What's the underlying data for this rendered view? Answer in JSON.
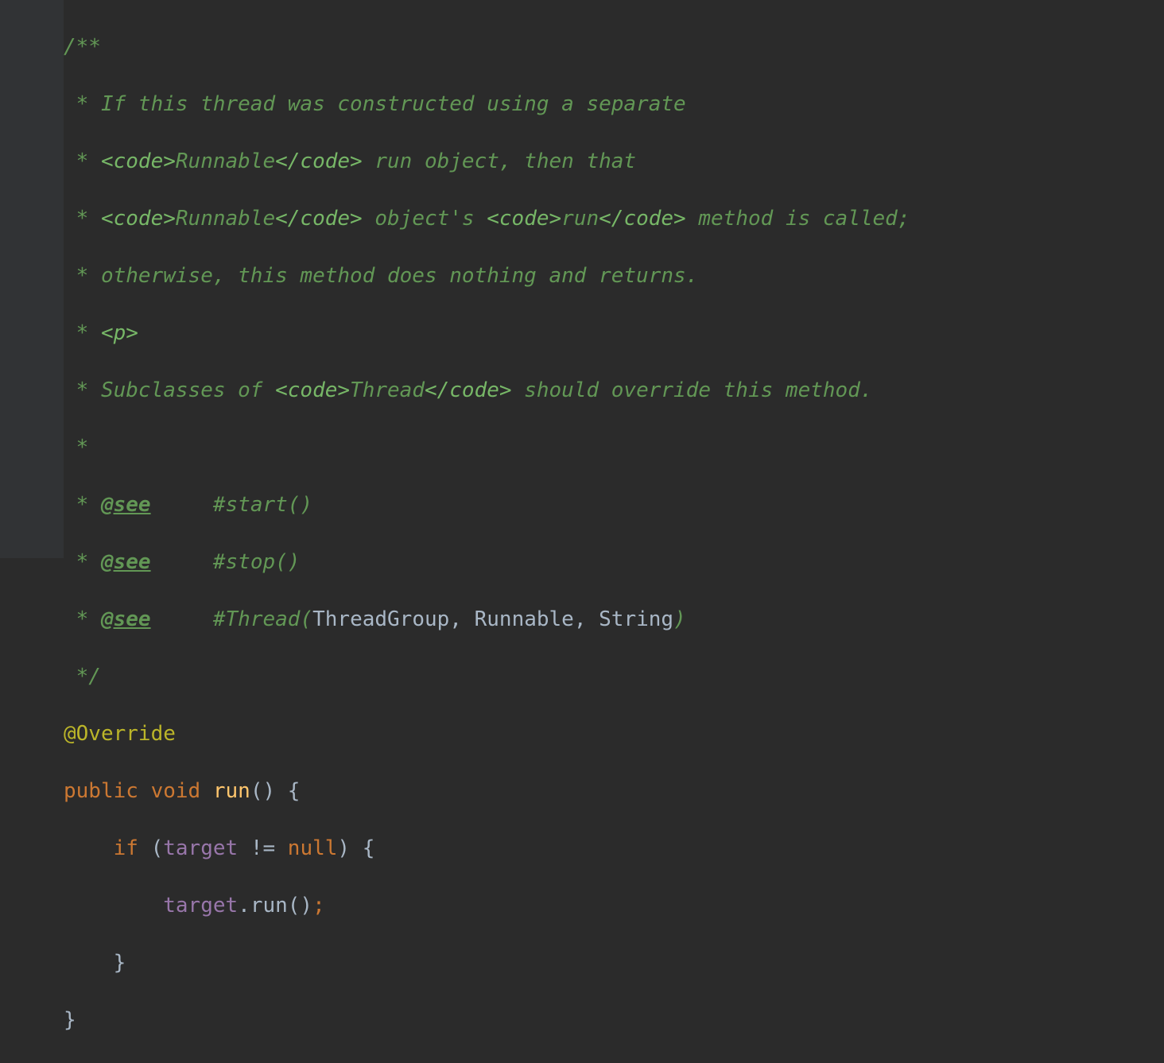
{
  "code": {
    "l1": {
      "t1": "/**"
    },
    "l2": {
      "t1": " * ",
      "t2": "If this thread was constructed using a separate"
    },
    "l3": {
      "t1": " * ",
      "t2": "<code>",
      "t3": "Runnable",
      "t4": "</code> ",
      "t5": "run object, then that"
    },
    "l4": {
      "t1": " * ",
      "t2": "<code>",
      "t3": "Runnable",
      "t4": "</code> ",
      "t5": "object's ",
      "t6": "<code>",
      "t7": "run",
      "t8": "</code> ",
      "t9": "method is called;"
    },
    "l5": {
      "t1": " * ",
      "t2": "otherwise, this method does nothing and returns."
    },
    "l6": {
      "t1": " * ",
      "t2": "<p>"
    },
    "l7": {
      "t1": " * ",
      "t2": "Subclasses of ",
      "t3": "<code>",
      "t4": "Thread",
      "t5": "</code> ",
      "t6": "should override this method."
    },
    "l8": {
      "t1": " *"
    },
    "l9": {
      "t1": " * ",
      "t2": "@see",
      "t3": "     ",
      "t4": "#start()"
    },
    "l10": {
      "t1": " * ",
      "t2": "@see",
      "t3": "     ",
      "t4": "#stop()"
    },
    "l11": {
      "t1": " * ",
      "t2": "@see",
      "t3": "     ",
      "t4": "#Thread(",
      "t5": "ThreadGroup, Runnable, String",
      "t6": ")"
    },
    "l12": {
      "t1": " */"
    },
    "l13": {
      "t1": "@Override"
    },
    "l14": {
      "t1": "public",
      "t2": " ",
      "t3": "void",
      "t4": " ",
      "t5": "run",
      "t6": "() {"
    },
    "l15": {
      "t1": "    ",
      "t2": "if",
      "t3": " (",
      "t4": "target",
      "t5": " != ",
      "t6": "null",
      "t7": ") {"
    },
    "l16": {
      "t1": "        ",
      "t2": "target",
      "t3": ".",
      "t4": "run",
      "t5": "()",
      "t6": ";"
    },
    "l17": {
      "t1": "    }"
    },
    "l18": {
      "t1": "}"
    }
  }
}
